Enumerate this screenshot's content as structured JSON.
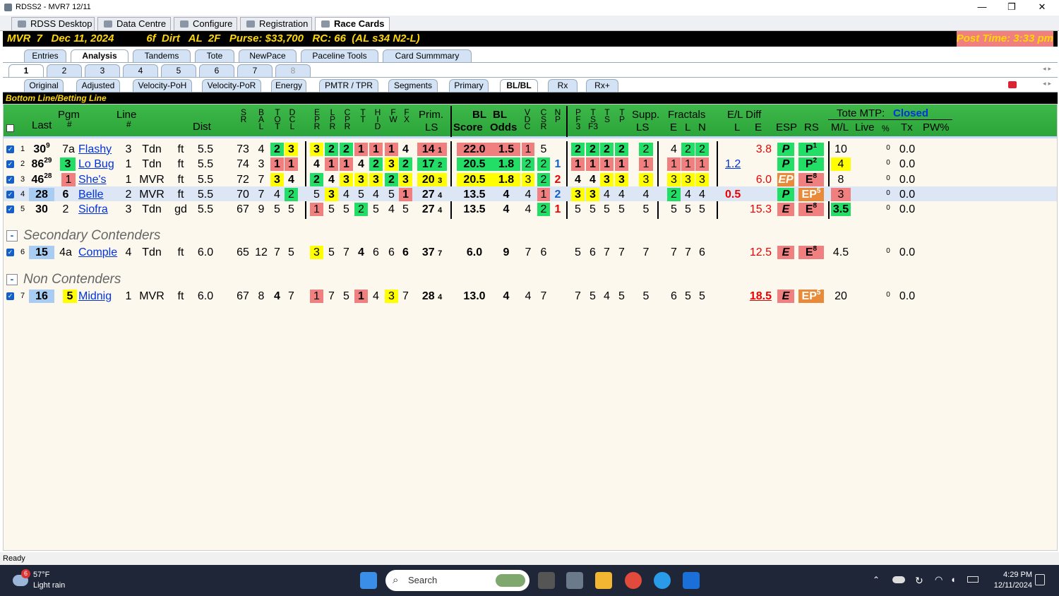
{
  "window": {
    "title": "RDSS2 - MVR7  12/11",
    "min": "—",
    "max": "❐",
    "close": "✕"
  },
  "main_tabs": [
    {
      "label": "RDSS Desktop"
    },
    {
      "label": "Data Centre"
    },
    {
      "label": "Configure"
    },
    {
      "label": "Registration"
    },
    {
      "label": "Race Cards"
    }
  ],
  "race_header": {
    "left": "MVR  7   Dec 11, 2024           6f  Dirt   AL  2F   Purse: $33,700   RC: 66  (AL s34 N2-L)",
    "right": "Post Time: 3:33 pm"
  },
  "view_tabs": [
    "Entries",
    "Analysis",
    "Tandems",
    "Tote",
    "NewPace",
    "Paceline Tools",
    "Card Summmary"
  ],
  "race_tabs": [
    "1",
    "2",
    "3",
    "4",
    "5",
    "6",
    "7",
    "8"
  ],
  "sub_tabs": [
    "Original",
    "Adjusted",
    "Velocity-PoH",
    "Velocity-PoR",
    "Energy",
    "PMTR / TPR",
    "Segments",
    "Primary",
    "BL/BL",
    "Rx",
    "Rx+"
  ],
  "section_title": "Bottom Line/Betting Line",
  "headers": {
    "last": "Last",
    "pgm": "Pgm",
    "pgm_hash": "#",
    "line": "Line",
    "line_hash": "#",
    "dist": "Dist",
    "sr": "S\nR",
    "bal": "B\nA\nL",
    "tot": "T\nO\nT",
    "dcl": "D\nC\nL",
    "epr": "E\nP\nR",
    "lpr": "L\nP\nR",
    "cpr": "C\nP\nR",
    "tt": "T\nT",
    "hid": "H\nI\nD",
    "fw": "F\nW",
    "fx": "F\nX",
    "prim": "Prim.",
    "ls": "LS",
    "bl1": "BL",
    "bl2": "BL",
    "score": "Score",
    "odds": "Odds",
    "vdc": "V\nD\nC",
    "csr": "C\nS\nR",
    "np": "N\nP",
    "pf3": "P\nF\n3",
    "tsf3": "T\nS\nF3",
    "ts": "T\nS",
    "tp": "T\nP",
    "supp": "Supp.",
    "supp_ls": "LS",
    "fractals": "Fractals",
    "e": "E",
    "l": "L",
    "n": "N",
    "eldiff": "E/L Diff",
    "el_l": "L",
    "el_e": "E",
    "esp": "ESP",
    "rs": "RS",
    "tote": "Tote MTP:",
    "tote_status": "Closed",
    "ml": "M/L",
    "live": "Live",
    "pct": "%",
    "tx": "Tx",
    "pw": "PW%"
  },
  "rows": [
    {
      "idx": "1",
      "last": "30",
      "lastsup": "9",
      "pgm": "7a",
      "name": "Flashy",
      "line": "3",
      "trk": "Tdn",
      "cond": "ft",
      "dist": "5.5",
      "sr": "73",
      "bal": "4",
      "tot": "2",
      "dcl": "3",
      "epr": "3",
      "lpr": "2",
      "cpr": "2",
      "tt": "1",
      "hid": "1",
      "fw": "1",
      "fx": "4",
      "prim": "14",
      "primsup": "1",
      "score": "22.0",
      "odds": "1.5",
      "vdc": "1",
      "csr": "5",
      "np": "",
      "pf3": "2",
      "tsf3": "2",
      "ts": "2",
      "tp": "2",
      "supp": "2",
      "fe": "4",
      "fl": "2",
      "fn": "2",
      "ell": "",
      "ele": "3.8",
      "esp": "P",
      "rs": "P",
      "rssup": "1",
      "ml": "10",
      "live": "0",
      "tx": "0.0"
    },
    {
      "idx": "2",
      "last": "86",
      "lastsup": "29",
      "pgm": "3",
      "name": "Lo Bug",
      "line": "1",
      "trk": "Tdn",
      "cond": "ft",
      "dist": "5.5",
      "sr": "74",
      "bal": "3",
      "tot": "1",
      "dcl": "1",
      "epr": "4",
      "lpr": "1",
      "cpr": "1",
      "tt": "4",
      "hid": "2",
      "fw": "3",
      "fx": "2",
      "prim": "17",
      "primsup": "2",
      "score": "20.5",
      "odds": "1.8",
      "vdc": "2",
      "csr": "2",
      "np": "1",
      "pf3": "1",
      "tsf3": "1",
      "ts": "1",
      "tp": "1",
      "supp": "1",
      "fe": "1",
      "fl": "1",
      "fn": "1",
      "ell": "1.2",
      "ele": "",
      "esp": "P",
      "rs": "P",
      "rssup": "2",
      "ml": "4",
      "live": "0",
      "tx": "0.0"
    },
    {
      "idx": "3",
      "last": "46",
      "lastsup": "28",
      "pgm": "1",
      "name": "She's",
      "line": "1",
      "trk": "MVR",
      "cond": "ft",
      "dist": "5.5",
      "sr": "72",
      "bal": "7",
      "tot": "3",
      "dcl": "4",
      "epr": "2",
      "lpr": "4",
      "cpr": "3",
      "tt": "3",
      "hid": "3",
      "fw": "2",
      "fx": "3",
      "prim": "20",
      "primsup": "3",
      "score": "20.5",
      "odds": "1.8",
      "vdc": "3",
      "csr": "2",
      "np": "2",
      "pf3": "4",
      "tsf3": "4",
      "ts": "3",
      "tp": "3",
      "supp": "3",
      "fe": "3",
      "fl": "3",
      "fn": "3",
      "ell": "",
      "ele": "6.0",
      "esp": "EP",
      "rs": "E",
      "rssup": "8",
      "ml": "8",
      "live": "0",
      "tx": "0.0"
    },
    {
      "idx": "4",
      "last": "28",
      "lastsup": "",
      "pgm": "6",
      "name": "Belle",
      "line": "2",
      "trk": "MVR",
      "cond": "ft",
      "dist": "5.5",
      "sr": "70",
      "bal": "7",
      "tot": "4",
      "dcl": "2",
      "epr": "5",
      "lpr": "3",
      "cpr": "4",
      "tt": "5",
      "hid": "4",
      "fw": "5",
      "fx": "1",
      "prim": "27",
      "primsup": "4",
      "score": "13.5",
      "odds": "4",
      "vdc": "4",
      "csr": "1",
      "np": "2",
      "pf3": "3",
      "tsf3": "3",
      "ts": "4",
      "tp": "4",
      "supp": "4",
      "fe": "2",
      "fl": "4",
      "fn": "4",
      "ell": "0.5",
      "ele": "",
      "esp": "P",
      "rs": "EP",
      "rssup": "5",
      "ml": "3",
      "live": "0",
      "tx": "0.0"
    },
    {
      "idx": "5",
      "last": "30",
      "lastsup": "",
      "pgm": "2",
      "name": "Siofra",
      "line": "3",
      "trk": "Tdn",
      "cond": "gd",
      "dist": "5.5",
      "sr": "67",
      "bal": "9",
      "tot": "5",
      "dcl": "5",
      "epr": "1",
      "lpr": "5",
      "cpr": "5",
      "tt": "2",
      "hid": "5",
      "fw": "4",
      "fx": "5",
      "prim": "27",
      "primsup": "4",
      "score": "13.5",
      "odds": "4",
      "vdc": "4",
      "csr": "2",
      "np": "1",
      "pf3": "5",
      "tsf3": "5",
      "ts": "5",
      "tp": "5",
      "supp": "5",
      "fe": "5",
      "fl": "5",
      "fn": "5",
      "ell": "",
      "ele": "15.3",
      "esp": "E",
      "rs": "E",
      "rssup": "8",
      "ml": "3.5",
      "live": "0",
      "tx": "0.0"
    }
  ],
  "secondary": {
    "title": "Secondary Contenders",
    "toggle": "-",
    "row": {
      "idx": "6",
      "last": "15",
      "pgm": "4a",
      "name": "Comple",
      "line": "4",
      "trk": "Tdn",
      "cond": "ft",
      "dist": "6.0",
      "sr": "65",
      "bal": "12",
      "tot": "7",
      "dcl": "5",
      "epr": "3",
      "lpr": "5",
      "cpr": "7",
      "tt": "4",
      "hid": "6",
      "fw": "6",
      "fx": "6",
      "prim": "37",
      "primsup": "7",
      "score": "6.0",
      "odds": "9",
      "vdc": "7",
      "csr": "6",
      "pf3": "5",
      "tsf3": "6",
      "ts": "7",
      "tp": "7",
      "supp": "7",
      "fe": "7",
      "fl": "7",
      "fn": "6",
      "ele": "12.5",
      "esp": "E",
      "rs": "E",
      "rssup": "8",
      "ml": "4.5",
      "live": "0",
      "tx": "0.0"
    }
  },
  "noncontenders": {
    "title": "Non Contenders",
    "toggle": "-",
    "row": {
      "idx": "7",
      "last": "16",
      "pgm": "5",
      "name": "Midnig",
      "line": "1",
      "trk": "MVR",
      "cond": "ft",
      "dist": "6.0",
      "sr": "67",
      "bal": "8",
      "tot": "4",
      "dcl": "7",
      "epr": "1",
      "lpr": "7",
      "cpr": "5",
      "tt": "1",
      "hid": "4",
      "fw": "3",
      "fx": "7",
      "prim": "28",
      "primsup": "4",
      "score": "13.0",
      "odds": "4",
      "vdc": "4",
      "csr": "7",
      "pf3": "7",
      "tsf3": "5",
      "ts": "4",
      "tp": "5",
      "supp": "5",
      "fe": "6",
      "fl": "5",
      "fn": "5",
      "ele": "18.5",
      "esp": "E",
      "rs": "EP",
      "rssup": "5",
      "ml": "20",
      "live": "0",
      "tx": "0.0"
    }
  },
  "status": "Ready",
  "taskbar": {
    "temp": "57°F",
    "weather": "Light rain",
    "badge": "6",
    "search": "Search",
    "time": "4:29 PM",
    "date": "12/11/2024"
  },
  "colors": {
    "green": "#22dd66",
    "yellow": "#ffff00",
    "red": "#f08080",
    "blue": "#a9cdf2",
    "orange": "#e88a3a"
  }
}
